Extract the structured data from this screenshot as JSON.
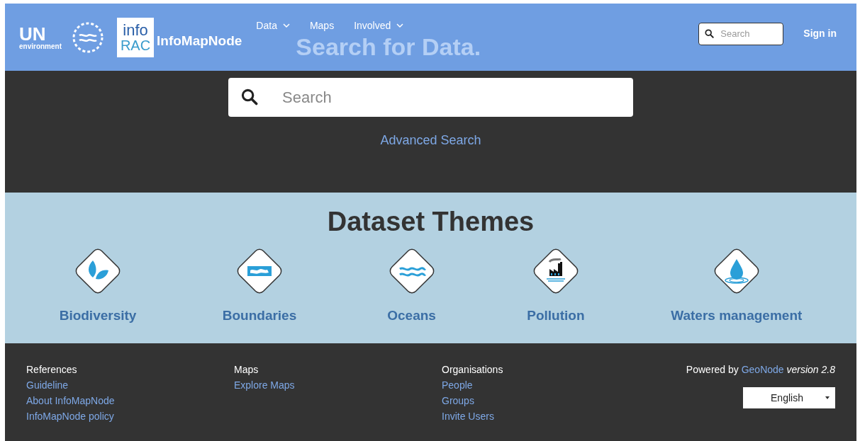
{
  "header": {
    "logos": {
      "un": "UN",
      "environment": "environment",
      "info": "info",
      "rac": "RAC"
    },
    "brand": "InfoMapNode",
    "nav": [
      {
        "label": "Data",
        "dropdown": true
      },
      {
        "label": "Maps",
        "dropdown": false
      },
      {
        "label": "Involved",
        "dropdown": true
      }
    ],
    "faded_heading": "Search for Data.",
    "search": {
      "placeholder": "Search"
    },
    "sign_in": "Sign in"
  },
  "hero": {
    "search": {
      "placeholder": "Search"
    },
    "advanced_search": "Advanced Search"
  },
  "themes": {
    "title": "Dataset Themes",
    "items": [
      {
        "kind": "leaf",
        "label": "Biodiversity"
      },
      {
        "kind": "map",
        "label": "Boundaries"
      },
      {
        "kind": "waves",
        "label": "Oceans"
      },
      {
        "kind": "factory",
        "label": "Pollution"
      },
      {
        "kind": "drop",
        "label": "Waters management"
      }
    ]
  },
  "footer": {
    "columns": [
      {
        "heading": "References",
        "links": [
          "Guideline",
          "About InfoMapNode",
          "InfoMapNode policy"
        ]
      },
      {
        "heading": "Maps",
        "links": [
          "Explore Maps"
        ]
      },
      {
        "heading": "Organisations",
        "links": [
          "People",
          "Groups",
          "Invite Users"
        ]
      }
    ],
    "powered_by": "Powered by",
    "geonode": "GeoNode",
    "version": "version 2.8",
    "language": "English"
  }
}
